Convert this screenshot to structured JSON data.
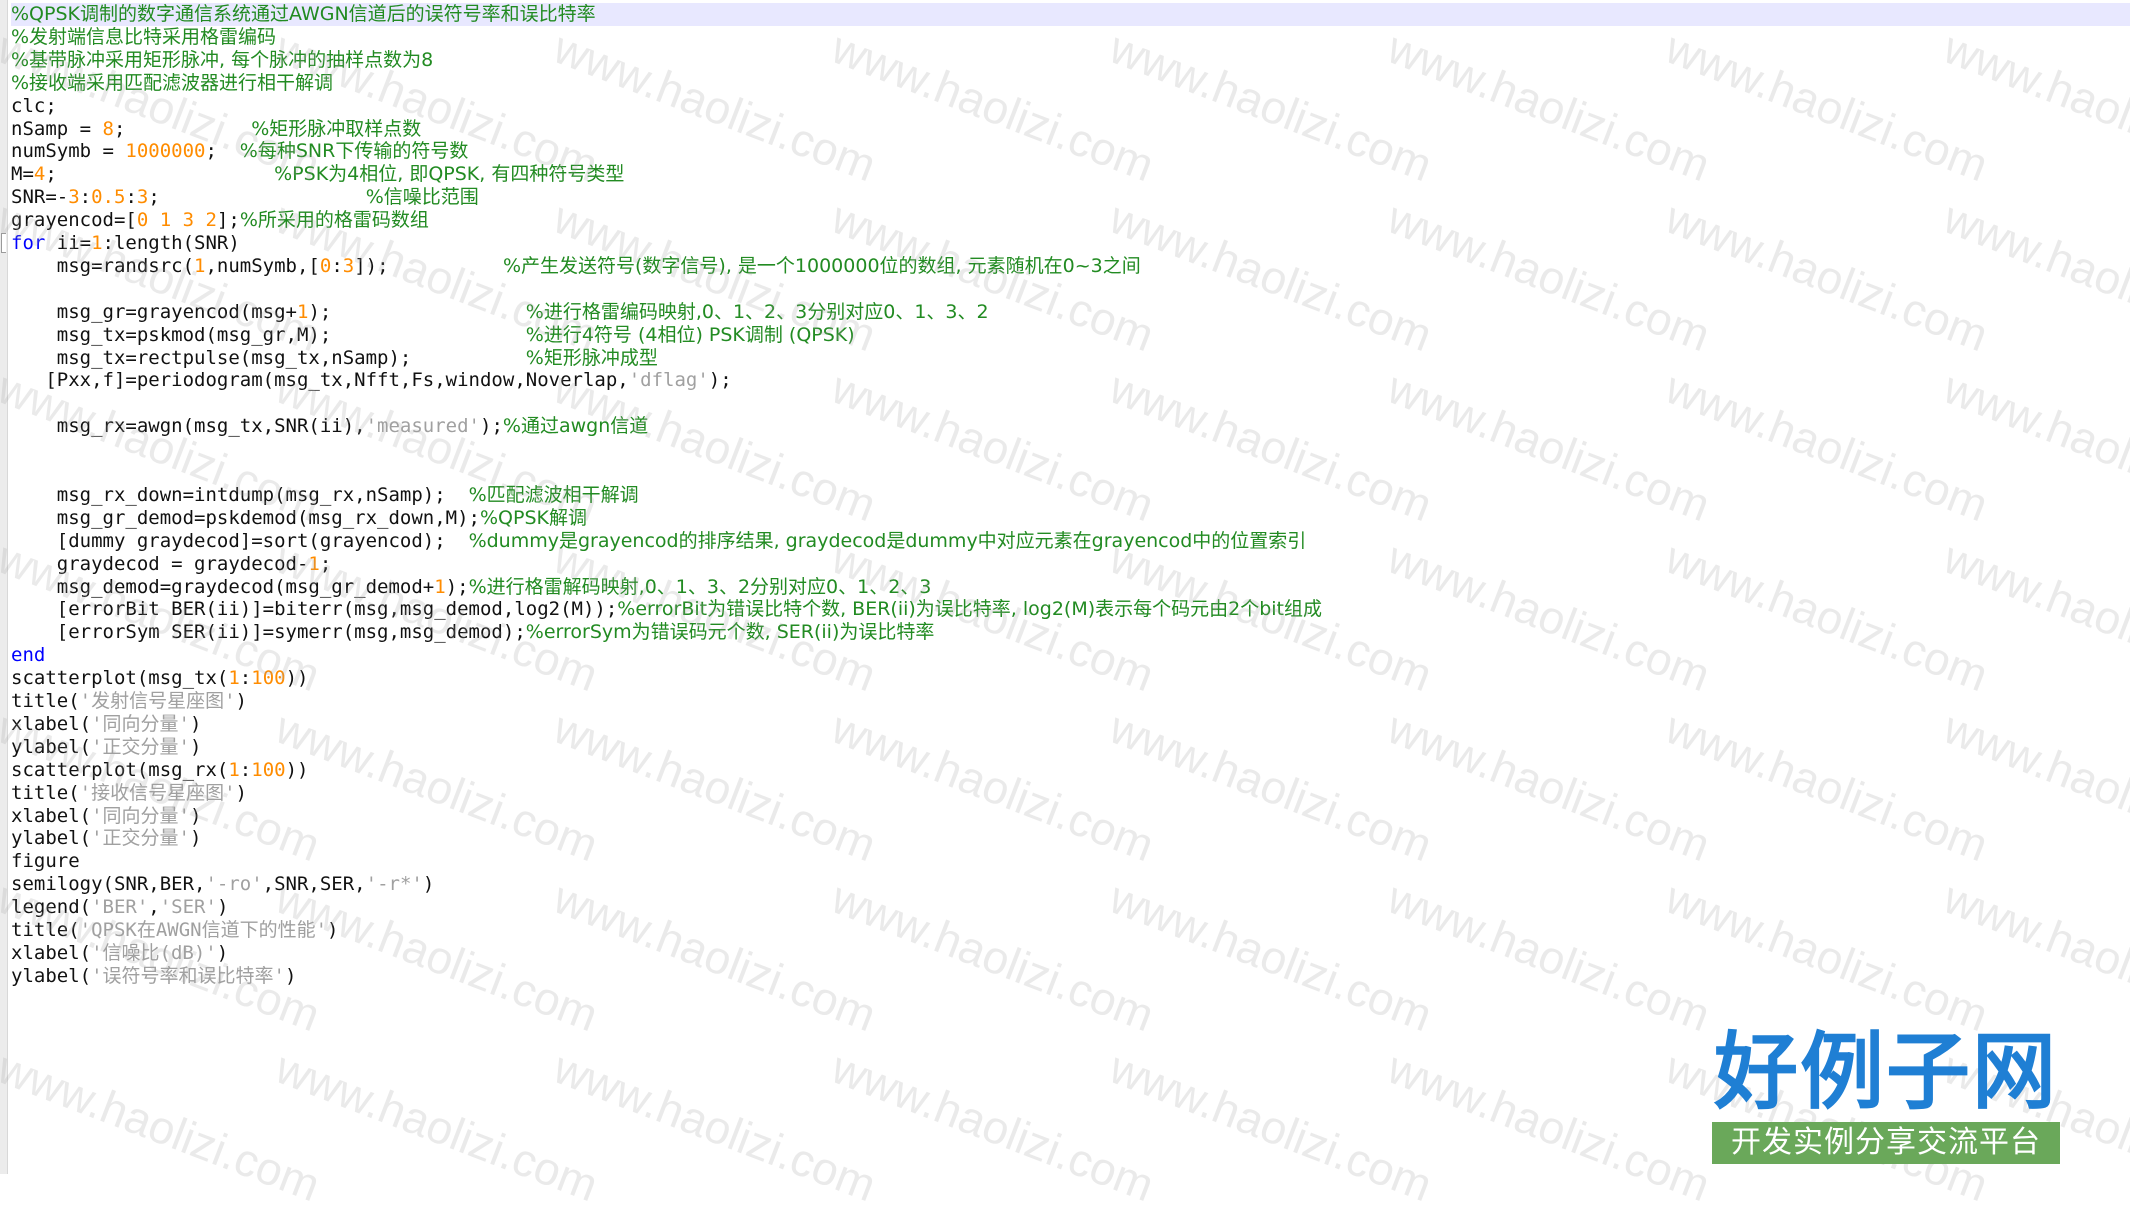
{
  "editor": {
    "lines": [
      [
        {
          "t": "%QPSK调制的数字通信系统通过AWGN信道后的误符号率和误比特率",
          "c": "cmt"
        }
      ],
      [
        {
          "t": "%发射端信息比特采用格雷编码",
          "c": "cmt"
        }
      ],
      [
        {
          "t": "%基带脉冲采用矩形脉冲, 每个脉冲的抽样点数为8",
          "c": "cmt"
        }
      ],
      [
        {
          "t": "%接收端采用匹配滤波器进行相干解调",
          "c": "cmt"
        }
      ],
      [
        {
          "t": "clc;"
        }
      ],
      [
        {
          "t": "nSamp = "
        },
        {
          "t": "8",
          "c": "num"
        },
        {
          "t": ";           "
        },
        {
          "t": "%矩形脉冲取样点数",
          "c": "cmt"
        }
      ],
      [
        {
          "t": "numSymb = "
        },
        {
          "t": "1000000",
          "c": "num"
        },
        {
          "t": ";  "
        },
        {
          "t": "%每种SNR下传输的符号数",
          "c": "cmt"
        }
      ],
      [
        {
          "t": "M="
        },
        {
          "t": "4",
          "c": "num"
        },
        {
          "t": ";                   "
        },
        {
          "t": "%PSK为4相位, 即QPSK, 有四种符号类型",
          "c": "cmt"
        }
      ],
      [
        {
          "t": "SNR=-"
        },
        {
          "t": "3",
          "c": "num"
        },
        {
          "t": ":"
        },
        {
          "t": "0.5",
          "c": "num"
        },
        {
          "t": ":"
        },
        {
          "t": "3",
          "c": "num"
        },
        {
          "t": ";                  "
        },
        {
          "t": "%信噪比范围",
          "c": "cmt"
        }
      ],
      [
        {
          "t": "grayencod=["
        },
        {
          "t": "0 1 3 2",
          "c": "num"
        },
        {
          "t": "];"
        },
        {
          "t": "%所采用的格雷码数组",
          "c": "cmt"
        }
      ],
      [
        {
          "t": "for",
          "c": "kw"
        },
        {
          "t": " ii="
        },
        {
          "t": "1",
          "c": "num"
        },
        {
          "t": ":length(SNR)"
        }
      ],
      [
        {
          "t": "    msg=randsrc("
        },
        {
          "t": "1",
          "c": "num"
        },
        {
          "t": ",numSymb,["
        },
        {
          "t": "0",
          "c": "num"
        },
        {
          "t": ":"
        },
        {
          "t": "3",
          "c": "num"
        },
        {
          "t": "]);          "
        },
        {
          "t": "%产生发送符号(数字信号), 是一个1000000位的数组, 元素随机在0~3之间",
          "c": "cmt"
        }
      ],
      [
        {
          "t": ""
        }
      ],
      [
        {
          "t": "    msg_gr=grayencod(msg+"
        },
        {
          "t": "1",
          "c": "num"
        },
        {
          "t": ");                 "
        },
        {
          "t": "%进行格雷编码映射,0、1、2、3分别对应0、1、3、2",
          "c": "cmt"
        }
      ],
      [
        {
          "t": "    msg_tx=pskmod(msg_gr,M);                 "
        },
        {
          "t": "%进行4符号 (4相位) PSK调制 (QPSK)",
          "c": "cmt"
        }
      ],
      [
        {
          "t": "    msg_tx=rectpulse(msg_tx,nSamp);          "
        },
        {
          "t": "%矩形脉冲成型",
          "c": "cmt"
        }
      ],
      [
        {
          "t": "   [Pxx,f]=periodogram(msg_tx,Nfft,Fs,window,Noverlap,"
        },
        {
          "t": "'dflag'",
          "c": "str"
        },
        {
          "t": ");"
        }
      ],
      [
        {
          "t": ""
        }
      ],
      [
        {
          "t": "    msg_rx=awgn(msg_tx,SNR(ii),"
        },
        {
          "t": "'measured'",
          "c": "str"
        },
        {
          "t": ");"
        },
        {
          "t": "%通过awgn信道",
          "c": "cmt"
        }
      ],
      [
        {
          "t": ""
        }
      ],
      [
        {
          "t": ""
        }
      ],
      [
        {
          "t": "    msg_rx_down=intdump(msg_rx,nSamp);  "
        },
        {
          "t": "%匹配滤波相干解调",
          "c": "cmt"
        }
      ],
      [
        {
          "t": "    msg_gr_demod=pskdemod(msg_rx_down,M);"
        },
        {
          "t": "%QPSK解调",
          "c": "cmt"
        }
      ],
      [
        {
          "t": "    [dummy graydecod]=sort(grayencod);  "
        },
        {
          "t": "%dummy是grayencod的排序结果, graydecod是dummy中对应元素在grayencod中的位置索引",
          "c": "cmt"
        }
      ],
      [
        {
          "t": "    graydecod = graydecod-"
        },
        {
          "t": "1",
          "c": "num"
        },
        {
          "t": ";"
        }
      ],
      [
        {
          "t": "    msg_demod=graydecod(msg_gr_demod+"
        },
        {
          "t": "1",
          "c": "num"
        },
        {
          "t": ");"
        },
        {
          "t": "%进行格雷解码映射,0、1、3、2分别对应0、1、2、3",
          "c": "cmt"
        }
      ],
      [
        {
          "t": "    [errorBit BER(ii)]=biterr(msg,msg_demod,log2(M));"
        },
        {
          "t": "%errorBit为错误比特个数, BER(ii)为误比特率, log2(M)表示每个码元由2个bit组成",
          "c": "cmt"
        }
      ],
      [
        {
          "t": "    [errorSym SER(ii)]=symerr(msg,msg_demod);"
        },
        {
          "t": "%errorSym为错误码元个数, SER(ii)为误比特率",
          "c": "cmt"
        }
      ],
      [
        {
          "t": "end",
          "c": "kw"
        }
      ],
      [
        {
          "t": "scatterplot(msg_tx("
        },
        {
          "t": "1",
          "c": "num"
        },
        {
          "t": ":"
        },
        {
          "t": "100",
          "c": "num"
        },
        {
          "t": "))"
        }
      ],
      [
        {
          "t": "title("
        },
        {
          "t": "'发射信号星座图'",
          "c": "str"
        },
        {
          "t": ")"
        }
      ],
      [
        {
          "t": "xlabel("
        },
        {
          "t": "'同向分量'",
          "c": "str"
        },
        {
          "t": ")"
        }
      ],
      [
        {
          "t": "ylabel("
        },
        {
          "t": "'正交分量'",
          "c": "str"
        },
        {
          "t": ")"
        }
      ],
      [
        {
          "t": "scatterplot(msg_rx("
        },
        {
          "t": "1",
          "c": "num"
        },
        {
          "t": ":"
        },
        {
          "t": "100",
          "c": "num"
        },
        {
          "t": "))"
        }
      ],
      [
        {
          "t": "title("
        },
        {
          "t": "'接收信号星座图'",
          "c": "str"
        },
        {
          "t": ")"
        }
      ],
      [
        {
          "t": "xlabel("
        },
        {
          "t": "'同向分量'",
          "c": "str"
        },
        {
          "t": ")"
        }
      ],
      [
        {
          "t": "ylabel("
        },
        {
          "t": "'正交分量'",
          "c": "str"
        },
        {
          "t": ")"
        }
      ],
      [
        {
          "t": "figure"
        }
      ],
      [
        {
          "t": "semilogy(SNR,BER,"
        },
        {
          "t": "'-ro'",
          "c": "str"
        },
        {
          "t": ",SNR,SER,"
        },
        {
          "t": "'-r*'",
          "c": "str"
        },
        {
          "t": ")"
        }
      ],
      [
        {
          "t": "legend("
        },
        {
          "t": "'BER'",
          "c": "str"
        },
        {
          "t": ","
        },
        {
          "t": "'SER'",
          "c": "str"
        },
        {
          "t": ")"
        }
      ],
      [
        {
          "t": "title("
        },
        {
          "t": "'QPSK在AWGN信道下的性能'",
          "c": "str"
        },
        {
          "t": ")"
        }
      ],
      [
        {
          "t": "xlabel("
        },
        {
          "t": "'信噪比(dB)'",
          "c": "str"
        },
        {
          "t": ")"
        }
      ],
      [
        {
          "t": "ylabel("
        },
        {
          "t": "'误符号率和误比特率'",
          "c": "str"
        },
        {
          "t": ")"
        }
      ]
    ]
  },
  "watermark": {
    "text": "www.haolizi.com"
  },
  "logo": {
    "title": "好例子网",
    "tagline": "开发实例分享交流平台"
  },
  "colors": {
    "keyword": "#0000ff",
    "number": "#ff8c00",
    "string": "#a0a0a0",
    "comment": "#228b22",
    "logo_blue": "#1f7fd4",
    "logo_green": "#6aa85a"
  }
}
